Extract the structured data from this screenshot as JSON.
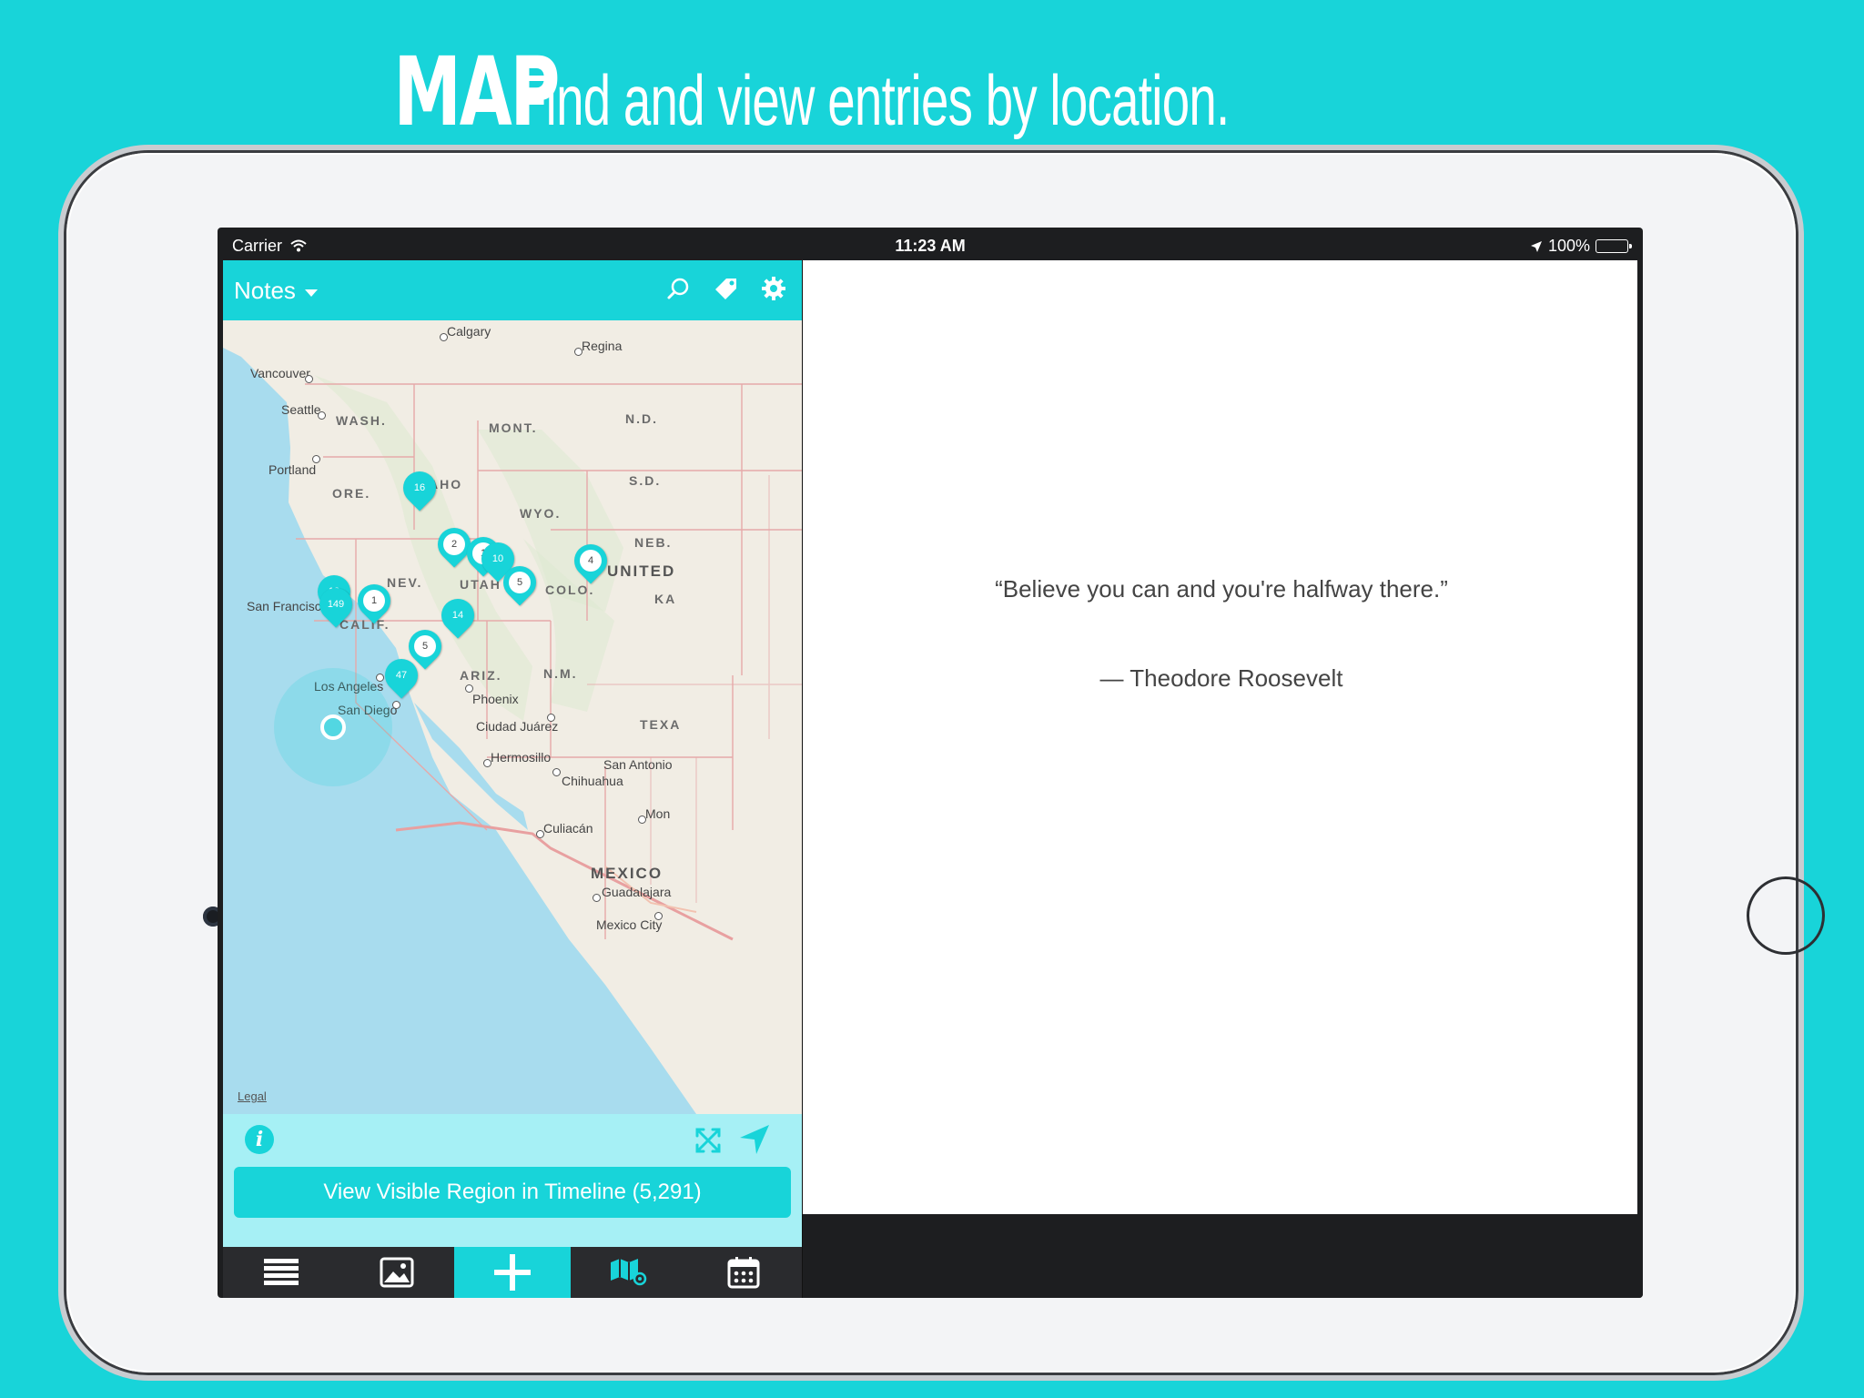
{
  "headline": {
    "strong": "MAP",
    "light": "Find and view entries by location."
  },
  "statusbar": {
    "carrier": "Carrier",
    "time": "11:23 AM",
    "battery": "100%"
  },
  "navbar": {
    "title": "Notes",
    "icons": [
      "search-icon",
      "tag-icon",
      "gear-icon"
    ]
  },
  "map": {
    "cities": {
      "calgary": "Calgary",
      "regina": "Regina",
      "vancouver": "Vancouver",
      "seattle": "Seattle",
      "portland": "Portland",
      "san_francisco": "San Francisco",
      "los_angeles": "Los Angeles",
      "san_diego": "San Diego",
      "phoenix": "Phoenix",
      "ciudad_juarez": "Ciudad Juárez",
      "hermosillo": "Hermosillo",
      "san_antonio": "San Antonio",
      "chihuahua": "Chihuahua",
      "culiacan": "Culiacán",
      "guadalajara": "Guadalajara",
      "mexico_city": "Mexico City",
      "mon": "Mon"
    },
    "states": {
      "wash": "WASH.",
      "mont": "MONT.",
      "nd": "N.D.",
      "sd": "S.D.",
      "ore": "ORE.",
      "idaho": "IDAHO",
      "wyo": "WYO.",
      "neb": "NEB.",
      "nev": "NEV.",
      "utah": "UTAH",
      "colo": "COLO.",
      "ka": "KA",
      "calif": "CALIF.",
      "ariz": "ARIZ.",
      "nm": "N.M.",
      "texa": "TEXA"
    },
    "countries": {
      "united": "UNITED",
      "mexico": "MEXICO"
    },
    "pins": {
      "idaho": "16",
      "utah_a": "2",
      "utah_b": "1",
      "utah_c": "10",
      "utah_d": "5",
      "colo": "4",
      "sf_a": "18",
      "sf_b": "149",
      "nev": "1",
      "ariz": "14",
      "nev_s": "5",
      "la": "47"
    },
    "legal": "Legal"
  },
  "mapbar": {
    "info": "i",
    "view_button": "View Visible Region in Timeline (5,291)"
  },
  "tabs": [
    "list-icon",
    "photo-icon",
    "add-icon",
    "map-icon",
    "calendar-icon"
  ],
  "quote": {
    "text": "“Believe you can and you're halfway there.”",
    "author": "— Theodore Roosevelt"
  },
  "colors": {
    "accent": "#18d4d9",
    "map_water": "#a8dcee",
    "map_land": "#f1ede4"
  }
}
